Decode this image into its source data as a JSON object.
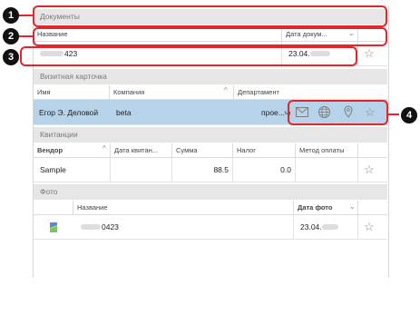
{
  "callouts": [
    "1",
    "2",
    "3",
    "4"
  ],
  "documents": {
    "title": "Документы",
    "columns": {
      "name": "Название",
      "date": "Дата докум..."
    },
    "row": {
      "name_suffix": "423",
      "date_prefix": "23.04."
    }
  },
  "business_card": {
    "title": "Визитная карточка",
    "columns": {
      "name": "Имя",
      "company": "Компания",
      "department": "Департамент"
    },
    "row": {
      "name": "Егор Э. Деловой",
      "company": "beta",
      "department": "прое...чени"
    }
  },
  "receipts": {
    "title": "Квитанции",
    "columns": {
      "vendor": "Вендор",
      "date": "Дата квитан...",
      "amount": "Сумма",
      "tax": "Налог",
      "payment": "Метод оплаты"
    },
    "row": {
      "vendor": "Sample",
      "date": "",
      "amount": "88.5",
      "tax": "0.0",
      "payment": ""
    }
  },
  "photos": {
    "title": "Фото",
    "columns": {
      "name": "Название",
      "date": "Дата фото"
    },
    "row": {
      "name_suffix": "0423",
      "date_prefix": "23.04."
    }
  }
}
